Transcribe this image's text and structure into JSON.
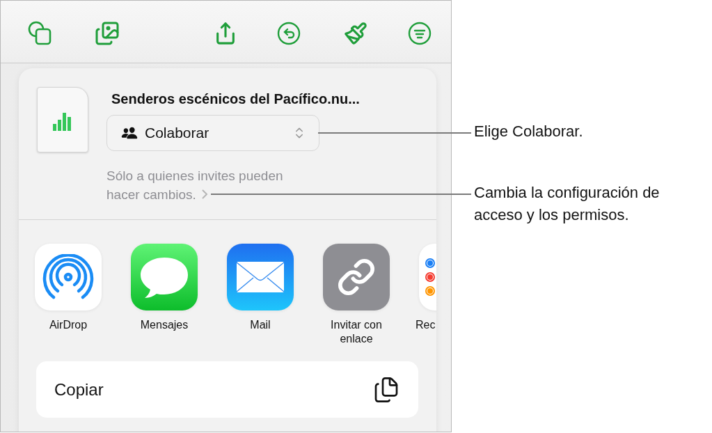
{
  "share_sheet": {
    "file": {
      "title": "Senderos escénicos del Pacífico.nu..."
    },
    "access": {
      "label": "Colaborar",
      "description": "Sólo a quienes invites pueden hacer cambios."
    },
    "apps": [
      {
        "kind": "airdrop",
        "label": "AirDrop"
      },
      {
        "kind": "messages",
        "label": "Mensajes"
      },
      {
        "kind": "mail",
        "label": "Mail"
      },
      {
        "kind": "link",
        "label": "Invitar con enlace"
      },
      {
        "kind": "reminders",
        "label": "Rec"
      }
    ],
    "actions": [
      {
        "label": "Copiar"
      }
    ]
  },
  "callouts": [
    {
      "text": "Elige Colaborar."
    },
    {
      "text": "Cambia la configuración de acceso y los permisos."
    }
  ]
}
